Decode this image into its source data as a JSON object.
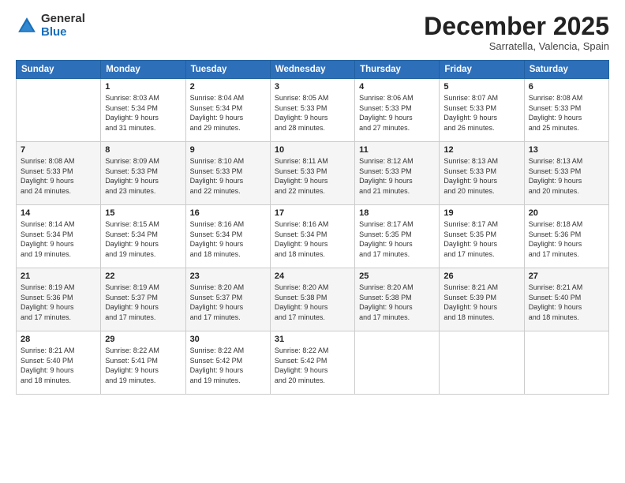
{
  "logo": {
    "general": "General",
    "blue": "Blue"
  },
  "title": "December 2025",
  "location": "Sarratella, Valencia, Spain",
  "headers": [
    "Sunday",
    "Monday",
    "Tuesday",
    "Wednesday",
    "Thursday",
    "Friday",
    "Saturday"
  ],
  "weeks": [
    [
      {
        "num": "",
        "info": ""
      },
      {
        "num": "1",
        "info": "Sunrise: 8:03 AM\nSunset: 5:34 PM\nDaylight: 9 hours\nand 31 minutes."
      },
      {
        "num": "2",
        "info": "Sunrise: 8:04 AM\nSunset: 5:34 PM\nDaylight: 9 hours\nand 29 minutes."
      },
      {
        "num": "3",
        "info": "Sunrise: 8:05 AM\nSunset: 5:33 PM\nDaylight: 9 hours\nand 28 minutes."
      },
      {
        "num": "4",
        "info": "Sunrise: 8:06 AM\nSunset: 5:33 PM\nDaylight: 9 hours\nand 27 minutes."
      },
      {
        "num": "5",
        "info": "Sunrise: 8:07 AM\nSunset: 5:33 PM\nDaylight: 9 hours\nand 26 minutes."
      },
      {
        "num": "6",
        "info": "Sunrise: 8:08 AM\nSunset: 5:33 PM\nDaylight: 9 hours\nand 25 minutes."
      }
    ],
    [
      {
        "num": "7",
        "info": "Sunrise: 8:08 AM\nSunset: 5:33 PM\nDaylight: 9 hours\nand 24 minutes."
      },
      {
        "num": "8",
        "info": "Sunrise: 8:09 AM\nSunset: 5:33 PM\nDaylight: 9 hours\nand 23 minutes."
      },
      {
        "num": "9",
        "info": "Sunrise: 8:10 AM\nSunset: 5:33 PM\nDaylight: 9 hours\nand 22 minutes."
      },
      {
        "num": "10",
        "info": "Sunrise: 8:11 AM\nSunset: 5:33 PM\nDaylight: 9 hours\nand 22 minutes."
      },
      {
        "num": "11",
        "info": "Sunrise: 8:12 AM\nSunset: 5:33 PM\nDaylight: 9 hours\nand 21 minutes."
      },
      {
        "num": "12",
        "info": "Sunrise: 8:13 AM\nSunset: 5:33 PM\nDaylight: 9 hours\nand 20 minutes."
      },
      {
        "num": "13",
        "info": "Sunrise: 8:13 AM\nSunset: 5:33 PM\nDaylight: 9 hours\nand 20 minutes."
      }
    ],
    [
      {
        "num": "14",
        "info": "Sunrise: 8:14 AM\nSunset: 5:34 PM\nDaylight: 9 hours\nand 19 minutes."
      },
      {
        "num": "15",
        "info": "Sunrise: 8:15 AM\nSunset: 5:34 PM\nDaylight: 9 hours\nand 19 minutes."
      },
      {
        "num": "16",
        "info": "Sunrise: 8:16 AM\nSunset: 5:34 PM\nDaylight: 9 hours\nand 18 minutes."
      },
      {
        "num": "17",
        "info": "Sunrise: 8:16 AM\nSunset: 5:34 PM\nDaylight: 9 hours\nand 18 minutes."
      },
      {
        "num": "18",
        "info": "Sunrise: 8:17 AM\nSunset: 5:35 PM\nDaylight: 9 hours\nand 17 minutes."
      },
      {
        "num": "19",
        "info": "Sunrise: 8:17 AM\nSunset: 5:35 PM\nDaylight: 9 hours\nand 17 minutes."
      },
      {
        "num": "20",
        "info": "Sunrise: 8:18 AM\nSunset: 5:36 PM\nDaylight: 9 hours\nand 17 minutes."
      }
    ],
    [
      {
        "num": "21",
        "info": "Sunrise: 8:19 AM\nSunset: 5:36 PM\nDaylight: 9 hours\nand 17 minutes."
      },
      {
        "num": "22",
        "info": "Sunrise: 8:19 AM\nSunset: 5:37 PM\nDaylight: 9 hours\nand 17 minutes."
      },
      {
        "num": "23",
        "info": "Sunrise: 8:20 AM\nSunset: 5:37 PM\nDaylight: 9 hours\nand 17 minutes."
      },
      {
        "num": "24",
        "info": "Sunrise: 8:20 AM\nSunset: 5:38 PM\nDaylight: 9 hours\nand 17 minutes."
      },
      {
        "num": "25",
        "info": "Sunrise: 8:20 AM\nSunset: 5:38 PM\nDaylight: 9 hours\nand 17 minutes."
      },
      {
        "num": "26",
        "info": "Sunrise: 8:21 AM\nSunset: 5:39 PM\nDaylight: 9 hours\nand 18 minutes."
      },
      {
        "num": "27",
        "info": "Sunrise: 8:21 AM\nSunset: 5:40 PM\nDaylight: 9 hours\nand 18 minutes."
      }
    ],
    [
      {
        "num": "28",
        "info": "Sunrise: 8:21 AM\nSunset: 5:40 PM\nDaylight: 9 hours\nand 18 minutes."
      },
      {
        "num": "29",
        "info": "Sunrise: 8:22 AM\nSunset: 5:41 PM\nDaylight: 9 hours\nand 19 minutes."
      },
      {
        "num": "30",
        "info": "Sunrise: 8:22 AM\nSunset: 5:42 PM\nDaylight: 9 hours\nand 19 minutes."
      },
      {
        "num": "31",
        "info": "Sunrise: 8:22 AM\nSunset: 5:42 PM\nDaylight: 9 hours\nand 20 minutes."
      },
      {
        "num": "",
        "info": ""
      },
      {
        "num": "",
        "info": ""
      },
      {
        "num": "",
        "info": ""
      }
    ]
  ]
}
